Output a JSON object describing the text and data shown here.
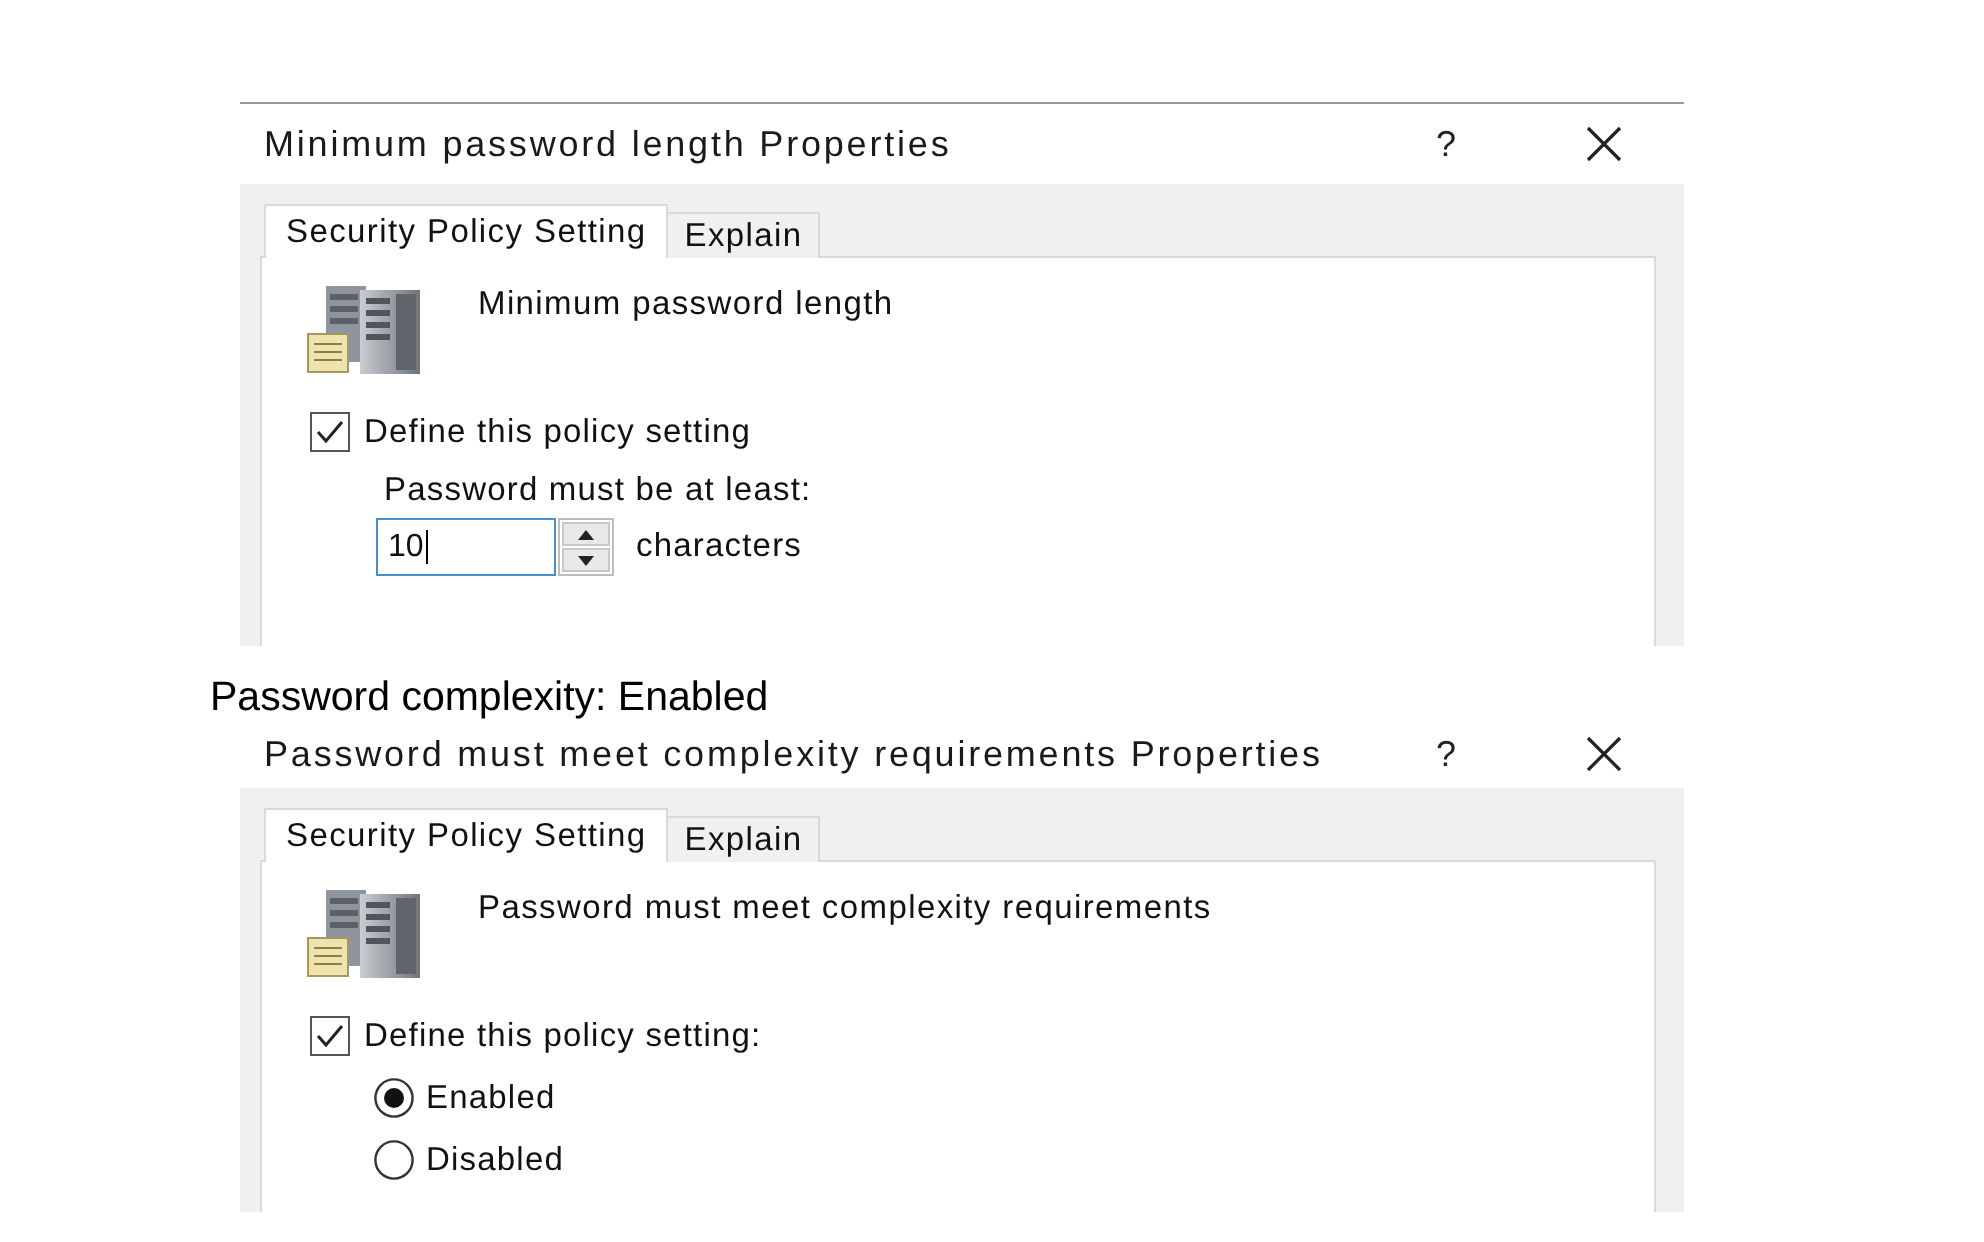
{
  "sections": [
    {
      "kind": "dialog",
      "title": "Minimum password length Properties",
      "help": "?",
      "tabs": [
        {
          "label": "Security Policy Setting",
          "selected": true
        },
        {
          "label": "Explain",
          "selected": false
        }
      ],
      "policy": "Minimum password length",
      "define": {
        "label": "Define this policy setting",
        "checked": true
      },
      "setting": {
        "kind": "spinner",
        "label": "Password must be at least:",
        "value": "10",
        "focused": true,
        "unit": "characters"
      }
    },
    {
      "kind": "caption",
      "text": "Password complexity: Enabled"
    },
    {
      "kind": "dialog",
      "title": "Password must meet complexity requirements Properties",
      "help": "?",
      "tabs": [
        {
          "label": "Security Policy Setting",
          "selected": true
        },
        {
          "label": "Explain",
          "selected": false
        }
      ],
      "policy": "Password must meet complexity requirements",
      "define": {
        "label": "Define this policy setting:",
        "checked": true
      },
      "setting": {
        "kind": "radios",
        "options": [
          {
            "label": "Enabled",
            "selected": true
          },
          {
            "label": "Disabled",
            "selected": false
          }
        ]
      }
    }
  ]
}
